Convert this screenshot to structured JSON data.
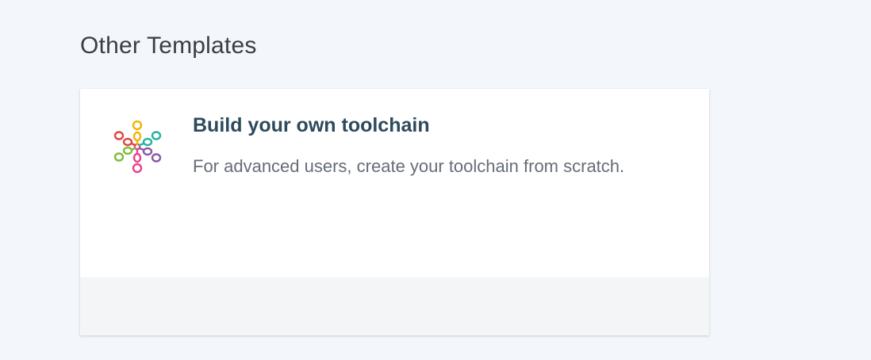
{
  "section": {
    "title": "Other Templates"
  },
  "templates": [
    {
      "title": "Build your own toolchain",
      "description": "For advanced users, create your toolchain from scratch.",
      "icon": "chain-links-logo-icon"
    }
  ],
  "colors": {
    "background": "#f3f6fa",
    "card_title": "#2d4a5c",
    "card_description": "#656d78",
    "footer": "#f4f5f7",
    "logo_links": [
      "#e0473f",
      "#f1b400",
      "#2ab2a0",
      "#7fbd3c",
      "#8a5aa6",
      "#e8418a"
    ]
  }
}
